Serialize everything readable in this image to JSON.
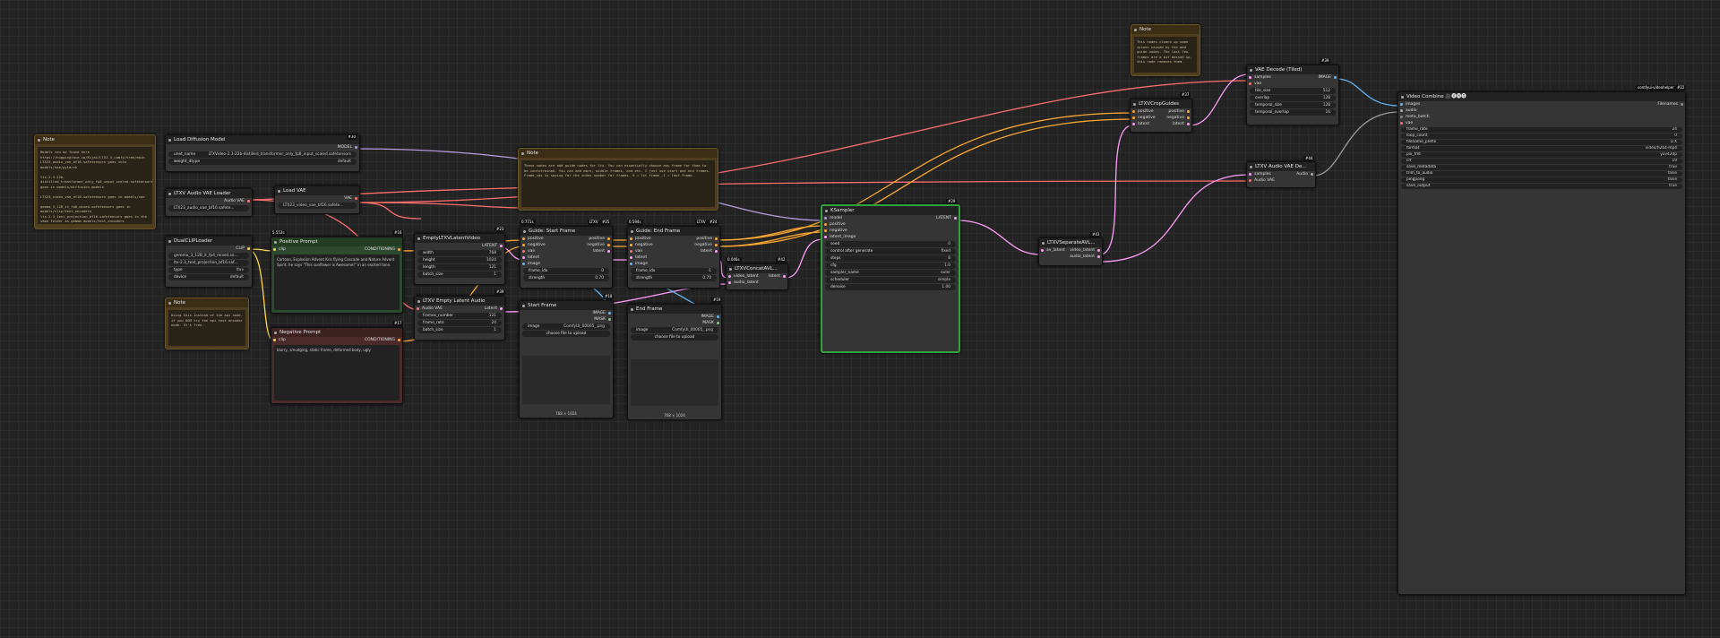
{
  "colors": {
    "model": "#b39ddb",
    "clip": "#ffd54f",
    "vae": "#ff6e6e",
    "latent": "#ff9cf9",
    "image": "#64b5f6",
    "cond": "#ffa931",
    "audio": "#aaa"
  },
  "n_note1": {
    "title": "Note",
    "body": "Models can be found here\nhttps://huggingface.co/Kijai/LTX2.3_comfy/tree/main\nLTX23_audio_vae_bf16.safetensors goes into models/vae/pytorch\n\nltx-2.3-22b-distilled_transformer_only_fp8_input_scaled.safetensors goes in models/diffusion_models\n\nLTX23_video_vae_bf16.safetensors goes in models/vae\n\ngemma_3_12B_it_fp8_mixed.safetensors goes in models/clip/text_encoders\nltx-2.3_text_projection_bf16.safetensors goes in the same folder as gemma models/text_encoders"
  },
  "n_note2": {
    "title": "Note",
    "body": "Using this instead of the api node, if you OOM try the api text encoder node. It's free."
  },
  "n_note3": {
    "title": "Note",
    "body": "These nodes are add guide nodes for ltx. You can essentially choose any frame for them to be contstrained. You can add more, middle frames, and etc. I just use start and end frames. Frame_idx is saying for the index number for frames. 0 = 1st frame -1 = last frame."
  },
  "n_note4": {
    "title": "Note",
    "body": "This nodes cleans up some issues caused by the add guide nodes. The last few frames are a bit messed up, this node removes them."
  },
  "n_ldm": {
    "title": "Load Diffusion Model",
    "badge": "#30",
    "out": "MODEL",
    "w1k": "unet_name",
    "w1v": "LTXVideo-2.3-22b-distilled_transformer_only_fp8_input_scaled.safetensors",
    "w2k": "weight_dtype",
    "w2v": "default"
  },
  "n_avae": {
    "title": "LTXV Audio VAE Loader",
    "badge": "#41",
    "out": "Audio VAE",
    "w1v": "LTX23_audio_vae_bf16.safete..."
  },
  "n_vae": {
    "title": "Load VAE",
    "badge": "#13",
    "out": "VAE",
    "w1v": "LTX23_video_vae_bf16.safete..."
  },
  "n_dual": {
    "title": "DualCLIPLoader",
    "badge": "#40",
    "out": "CLIP",
    "w1v": "gemma_3_12B_it_fp4_mixed.sa...",
    "w2v": "ltx-2.3_text_projection_bf16.saf...",
    "w3k": "type",
    "w3v": "ltxv",
    "w4k": "device",
    "w4v": "default"
  },
  "n_pos": {
    "title": "Positive Prompt",
    "badge": "#16",
    "time": "5.553s",
    "in": "clip",
    "out": "CONDITIONING",
    "text": "Cartoon, Explosion Advent Kris flying Cascade and Nature Advent Spirit, he says \"This sunflower is Awesome!\" in an excited tone."
  },
  "n_neg": {
    "title": "Negative Prompt",
    "badge": "#17",
    "in": "clip",
    "out": "CONDITIONING",
    "text": "blurry, smudging, static frame, deformed body, ugly"
  },
  "n_empty": {
    "title": "EmptyLTXVLatentVideo",
    "badge": "#23",
    "out": "LATENT",
    "w1k": "width",
    "w1v": "768",
    "w2k": "height",
    "w2v": "1024",
    "w3k": "length",
    "w3v": "121",
    "w4k": "batch_size",
    "w4v": "1"
  },
  "n_eaudio": {
    "title": "LTXV Empty Latent Audio",
    "badge": "#39",
    "in": "Audio VAE",
    "out": "Latent",
    "w1k": "frames_number",
    "w1v": "121",
    "w2k": "frame_rate",
    "w2v": "24",
    "w3k": "batch_size",
    "w3v": "1"
  },
  "n_gstart": {
    "title": "Guide: Start Frame",
    "badge": "#25",
    "time": "0.771s",
    "tag": "LTXV",
    "inputs": [
      "positive",
      "negative",
      "vae",
      "latent",
      "image"
    ],
    "outputs": [
      "positive",
      "negative",
      "latent"
    ],
    "w1k": "frame_idx",
    "w1v": "0",
    "w2k": "strength",
    "w2v": "0.70"
  },
  "n_gend": {
    "title": "Guide: End Frame",
    "badge": "#24",
    "time": "0.594s",
    "tag": "LTXV",
    "inputs": [
      "positive",
      "negative",
      "vae",
      "latent",
      "image"
    ],
    "outputs": [
      "positive",
      "negative",
      "latent"
    ],
    "w1k": "frame_idx",
    "w1v": "-1",
    "w2k": "strength",
    "w2v": "0.70"
  },
  "n_start": {
    "title": "Start Frame",
    "badge": "#18",
    "out1": "IMAGE",
    "out2": "MASK",
    "w1k": "image",
    "w1v": "ComfyUI_00005_.png",
    "btn": "choose file to upload",
    "dim": "768 × 1024"
  },
  "n_end": {
    "title": "End Frame",
    "badge": "#19",
    "out1": "IMAGE",
    "out2": "MASK",
    "w1k": "image",
    "w1v": "ComfyUI_00005_.png",
    "btn": "choose file to upload",
    "dim": "768 × 1024"
  },
  "n_concat": {
    "title": "LTXVConcatAVL...",
    "badge": "#42",
    "time": "0.046s",
    "in1": "video_latent",
    "in2": "audio_latent",
    "out": "latent"
  },
  "n_ks": {
    "title": "KSampler",
    "badge": "#29",
    "inputs": [
      "model",
      "positive",
      "negative",
      "latent_image"
    ],
    "out": "LATENT",
    "widgets": [
      [
        "seed",
        "0"
      ],
      [
        "control after generate",
        "fixed"
      ],
      [
        "steps",
        "8"
      ],
      [
        "cfg",
        "1.0"
      ],
      [
        "sampler_name",
        "euler"
      ],
      [
        "scheduler",
        "simple"
      ],
      [
        "denoise",
        "1.00"
      ]
    ]
  },
  "n_sep": {
    "title": "LTXVSeparateAVL...",
    "badge": "#43",
    "in": "av_latent",
    "out1": "video_latent",
    "out2": "audio_latent"
  },
  "n_crop": {
    "title": "LTXVCropGuides",
    "badge": "#37",
    "inputs": [
      "positive",
      "negative",
      "latent"
    ],
    "outputs": [
      "positive",
      "negative",
      "latent"
    ]
  },
  "n_vaed": {
    "title": "VAE Decode (Tiled)",
    "badge": "#39",
    "in1": "samples",
    "in2": "vae",
    "out": "IMAGE",
    "widgets": [
      [
        "tile_size",
        "512"
      ],
      [
        "overlap",
        "128"
      ],
      [
        "temporal_size",
        "128"
      ],
      [
        "temporal_overlap",
        "16"
      ]
    ]
  },
  "n_avaed": {
    "title": "LTXV Audio VAE De...",
    "badge": "#44",
    "in1": "samples",
    "in2": "Audio VAE",
    "out": "Audio"
  },
  "n_vc": {
    "title": "Video Combine 🎥🅥🅗🅢",
    "badge": "#22",
    "tag": "comfyui-videohelper",
    "inputs": [
      "images",
      "audio",
      "meta_batch",
      "vae"
    ],
    "out": "Filenames",
    "widgets": [
      [
        "frame_rate",
        "24"
      ],
      [
        "loop_count",
        "0"
      ],
      [
        "filename_prefix",
        "LTX"
      ],
      [
        "format",
        "video/h264-mp4"
      ],
      [
        "pix_fmt",
        "yuv420p"
      ],
      [
        "crf",
        "19"
      ],
      [
        "save_metadata",
        "true"
      ],
      [
        "trim_to_audio",
        "false"
      ],
      [
        "pingpong",
        "false"
      ],
      [
        "save_output",
        "true"
      ]
    ]
  }
}
